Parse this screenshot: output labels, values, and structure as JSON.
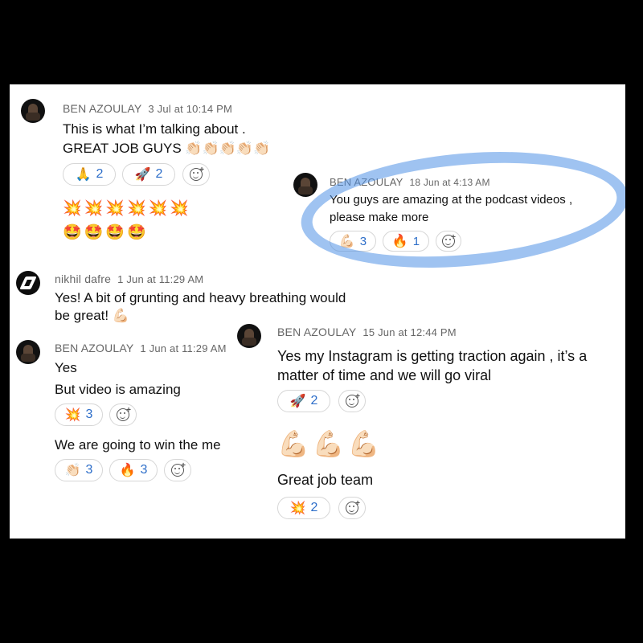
{
  "messages": [
    {
      "author": "BEN AZOULAY",
      "time": "3 Jul at 10:14 PM",
      "lines": [
        "This is what I’m talking about .",
        "GREAT JOB GUYS 👏🏻👏🏻👏🏻👏🏻👏🏻"
      ],
      "reactions": [
        {
          "emoji": "🙏",
          "count": "2"
        },
        {
          "emoji": "🚀",
          "count": "2"
        }
      ],
      "emoji_lines": [
        "💥💥💥💥💥💥",
        "🤩🤩🤩🤩"
      ]
    },
    {
      "author": "BEN AZOULAY",
      "time": "18 Jun at 4:13 AM",
      "lines": [
        "You guys are amazing at the podcast videos ,",
        "please make more"
      ],
      "reactions": [
        {
          "emoji": "💪🏻",
          "count": "3"
        },
        {
          "emoji": "🔥",
          "count": "1"
        }
      ]
    },
    {
      "author": "nikhil dafre",
      "time": "1 Jun at 11:29 AM",
      "lines": [
        "Yes! A bit of grunting and heavy breathing would",
        "be great! 💪🏻"
      ]
    },
    {
      "author": "BEN AZOULAY",
      "time": "1 Jun at 11:29 AM",
      "lines": [
        "Yes",
        "But video is amazing"
      ],
      "reactions": [
        {
          "emoji": "💥",
          "count": "3"
        }
      ],
      "followup": "We are going to win the me",
      "followup_reactions": [
        {
          "emoji": "👏🏻",
          "count": "3"
        },
        {
          "emoji": "🔥",
          "count": "3"
        }
      ]
    },
    {
      "author": "BEN AZOULAY",
      "time": "15 Jun at 12:44 PM",
      "lines": [
        "Yes my Instagram is getting traction again , it’s a",
        "matter of time and we will go viral"
      ],
      "reactions": [
        {
          "emoji": "🚀",
          "count": "2"
        }
      ],
      "big_emoji": "💪🏻💪🏻💪🏻",
      "followup": "Great job team",
      "followup_reactions": [
        {
          "emoji": "💥",
          "count": "2"
        }
      ]
    }
  ],
  "icons": {
    "add_reaction": "add-reaction-icon",
    "avatar": "avatar-photo",
    "logo": "slash-logo"
  },
  "colors": {
    "count": "#2d6ec9",
    "highlight": "#5091e6"
  }
}
